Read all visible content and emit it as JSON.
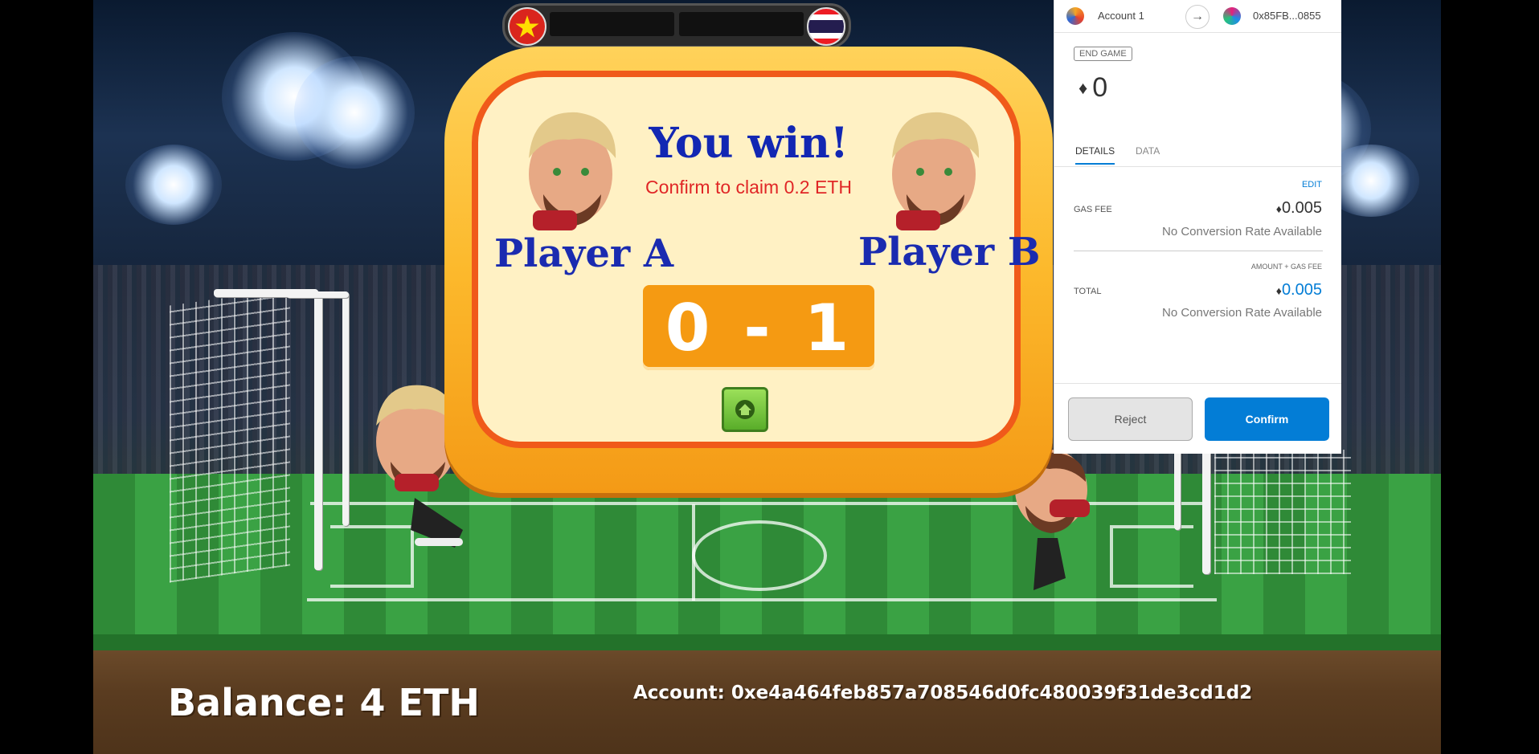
{
  "scoreboard": {
    "left_flag": "vietnam-flag-icon",
    "right_flag": "thailand-flag-icon"
  },
  "popup": {
    "title": "You win!",
    "claim_text": "Confirm to claim 0.2 ETH",
    "player_a": "Player A",
    "player_b": "Player B",
    "score_a": "0",
    "score_separator": "-",
    "score_b": "1",
    "home_icon": "home-icon"
  },
  "footer": {
    "balance": "Balance: 4 ETH",
    "account": "Account: 0xe4a464feb857a708546d0fc480039f31de3cd1d2"
  },
  "wallet": {
    "account_name": "Account 1",
    "recipient": "0x85FB...0855",
    "method_badge": "END GAME",
    "amount": "0",
    "tabs": [
      "DETAILS",
      "DATA"
    ],
    "edit_label": "EDIT",
    "gas_fee_label": "GAS FEE",
    "gas_fee_value": "0.005",
    "no_conversion": "No Conversion Rate Available",
    "amount_gas_label": "AMOUNT + GAS FEE",
    "total_label": "TOTAL",
    "total_value": "0.005",
    "no_conversion_total": "No Conversion Rate Available",
    "reject_label": "Reject",
    "confirm_label": "Confirm",
    "accent_color": "#037DD6"
  }
}
